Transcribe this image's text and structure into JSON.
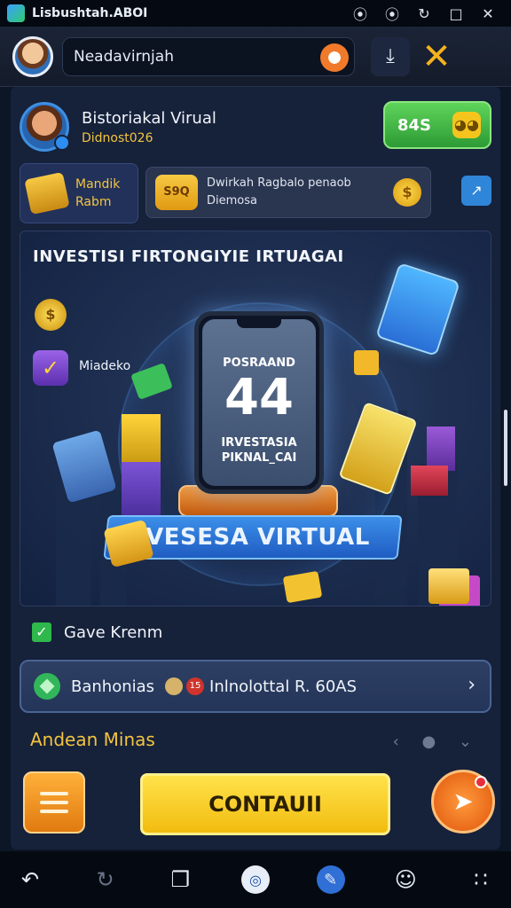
{
  "window": {
    "title": "Lisbushtah.ABOI",
    "controls": [
      "⦿",
      "⦿",
      "↻",
      "□",
      "✕"
    ]
  },
  "header": {
    "search_value": "Neadavirnjah",
    "download_icon": "download-icon",
    "close_icon": "close-icon"
  },
  "profile": {
    "name": "Bistoriakal Virual",
    "id": "Didnost026",
    "balance_button": "84S"
  },
  "row2": {
    "mandik_line1": "Mandik",
    "mandik_line2": "Rabm",
    "promo_icon_text": "S9Q",
    "promo_line1": "Dwirkah Ragbalo penaob",
    "promo_line2": "Diemosa",
    "promo_coin": "$"
  },
  "hero": {
    "title": "INVESTISI FIRTONGIYIE IRTUAGAI",
    "coin_label": "$",
    "side_label": "Miadeko",
    "screen_label": "POSRAAND",
    "screen_number": "44",
    "screen_sub_line1": "IRVESTASIA",
    "screen_sub_line2": "PIKNAL_CAI",
    "banner_text": "IVESESA VIRTUAL"
  },
  "checkbox": {
    "label": "Gave Krenm",
    "checked": true
  },
  "info_bar": {
    "text_a": "Banhonias",
    "badge": "15",
    "text_b": "Inlnolottal R. 60AS"
  },
  "section": {
    "title": "Andean Minas",
    "controls": "‹ ● ⌄"
  },
  "actions": {
    "continue_label": "CONTAUII"
  },
  "navbar": {
    "icons": [
      "back-icon",
      "refresh-icon",
      "tabs-icon",
      "target-icon",
      "edit-icon",
      "chat-icon",
      "grid-icon"
    ]
  },
  "colors": {
    "accent_yellow": "#f3c440",
    "accent_green": "#2fb84b",
    "accent_orange": "#e07a10",
    "panel": "#16213a"
  }
}
